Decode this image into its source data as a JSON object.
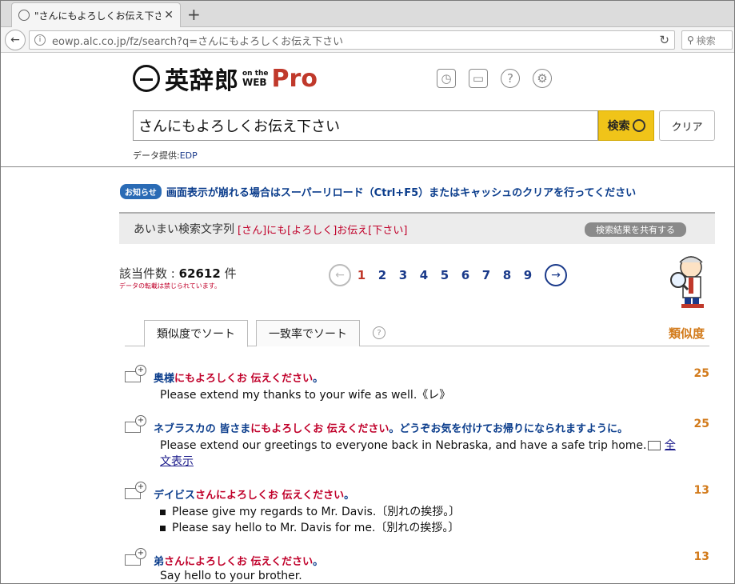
{
  "browser": {
    "tab_title": "\"さんにもよろしくお伝え下さい\"…",
    "url": "eowp.alc.co.jp/fz/search?q=さんにもよろしくお伝え下さい",
    "search_placeholder": "検索"
  },
  "header": {
    "logo_main": "英辞郎",
    "logo_on_the": "on the",
    "logo_web": "WEB",
    "logo_pro": "Pro"
  },
  "search": {
    "query": "さんにもよろしくお伝え下さい",
    "search_label": "検索",
    "clear_label": "クリア",
    "provider_label": "データ提供:",
    "provider_link": "EDP"
  },
  "notice": {
    "badge": "お知らせ",
    "text": "画面表示が崩れる場合はスーパーリロード（Ctrl+F5）またはキャッシュのクリアを行ってください"
  },
  "fuzzy": {
    "label": "あいまい検索文字列",
    "value": "[さん]にも[よろしく]お伝え[下さい]",
    "share_label": "検索結果を共有する"
  },
  "results_meta": {
    "count_label": "該当件数 :",
    "count": "62612",
    "count_unit": "件",
    "note": "データの転載は禁じられています。"
  },
  "pager": {
    "pages": [
      "1",
      "2",
      "3",
      "4",
      "5",
      "6",
      "7",
      "8",
      "9"
    ],
    "current": "1"
  },
  "sort": {
    "tab1": "類似度でソート",
    "tab2": "一致率でソート",
    "help": "?",
    "score_header": "類似度"
  },
  "results": [
    {
      "jp_pre": "奥様",
      "jp_hl": "にもよろしくお 伝えください",
      "jp_post": "。",
      "score": "25",
      "en": [
        "Please extend my thanks to your wife as well.《レ》"
      ]
    },
    {
      "jp_pre": "ネブラスカの 皆さま",
      "jp_hl": "にもよろしくお 伝えください",
      "jp_post": "。どうぞお気を付けてお帰りになられますように。",
      "score": "25",
      "en": [
        "Please extend our greetings to everyone back in Nebraska, and have a safe trip home."
      ],
      "fulltext_1": "全",
      "fulltext_2": "文表示"
    },
    {
      "jp_pre": "デイビス",
      "jp_hl": "さんによろしくお 伝えください",
      "jp_post": "。",
      "score": "13",
      "en": [
        "Please give my regards to Mr. Davis.〔別れの挨拶。〕",
        "Please say hello to Mr. Davis for me.〔別れの挨拶。〕"
      ]
    },
    {
      "jp_pre": "弟",
      "jp_hl": "さんによろしくお 伝えください",
      "jp_post": "。",
      "score": "13",
      "en": [
        "Say hello to your brother."
      ]
    }
  ]
}
